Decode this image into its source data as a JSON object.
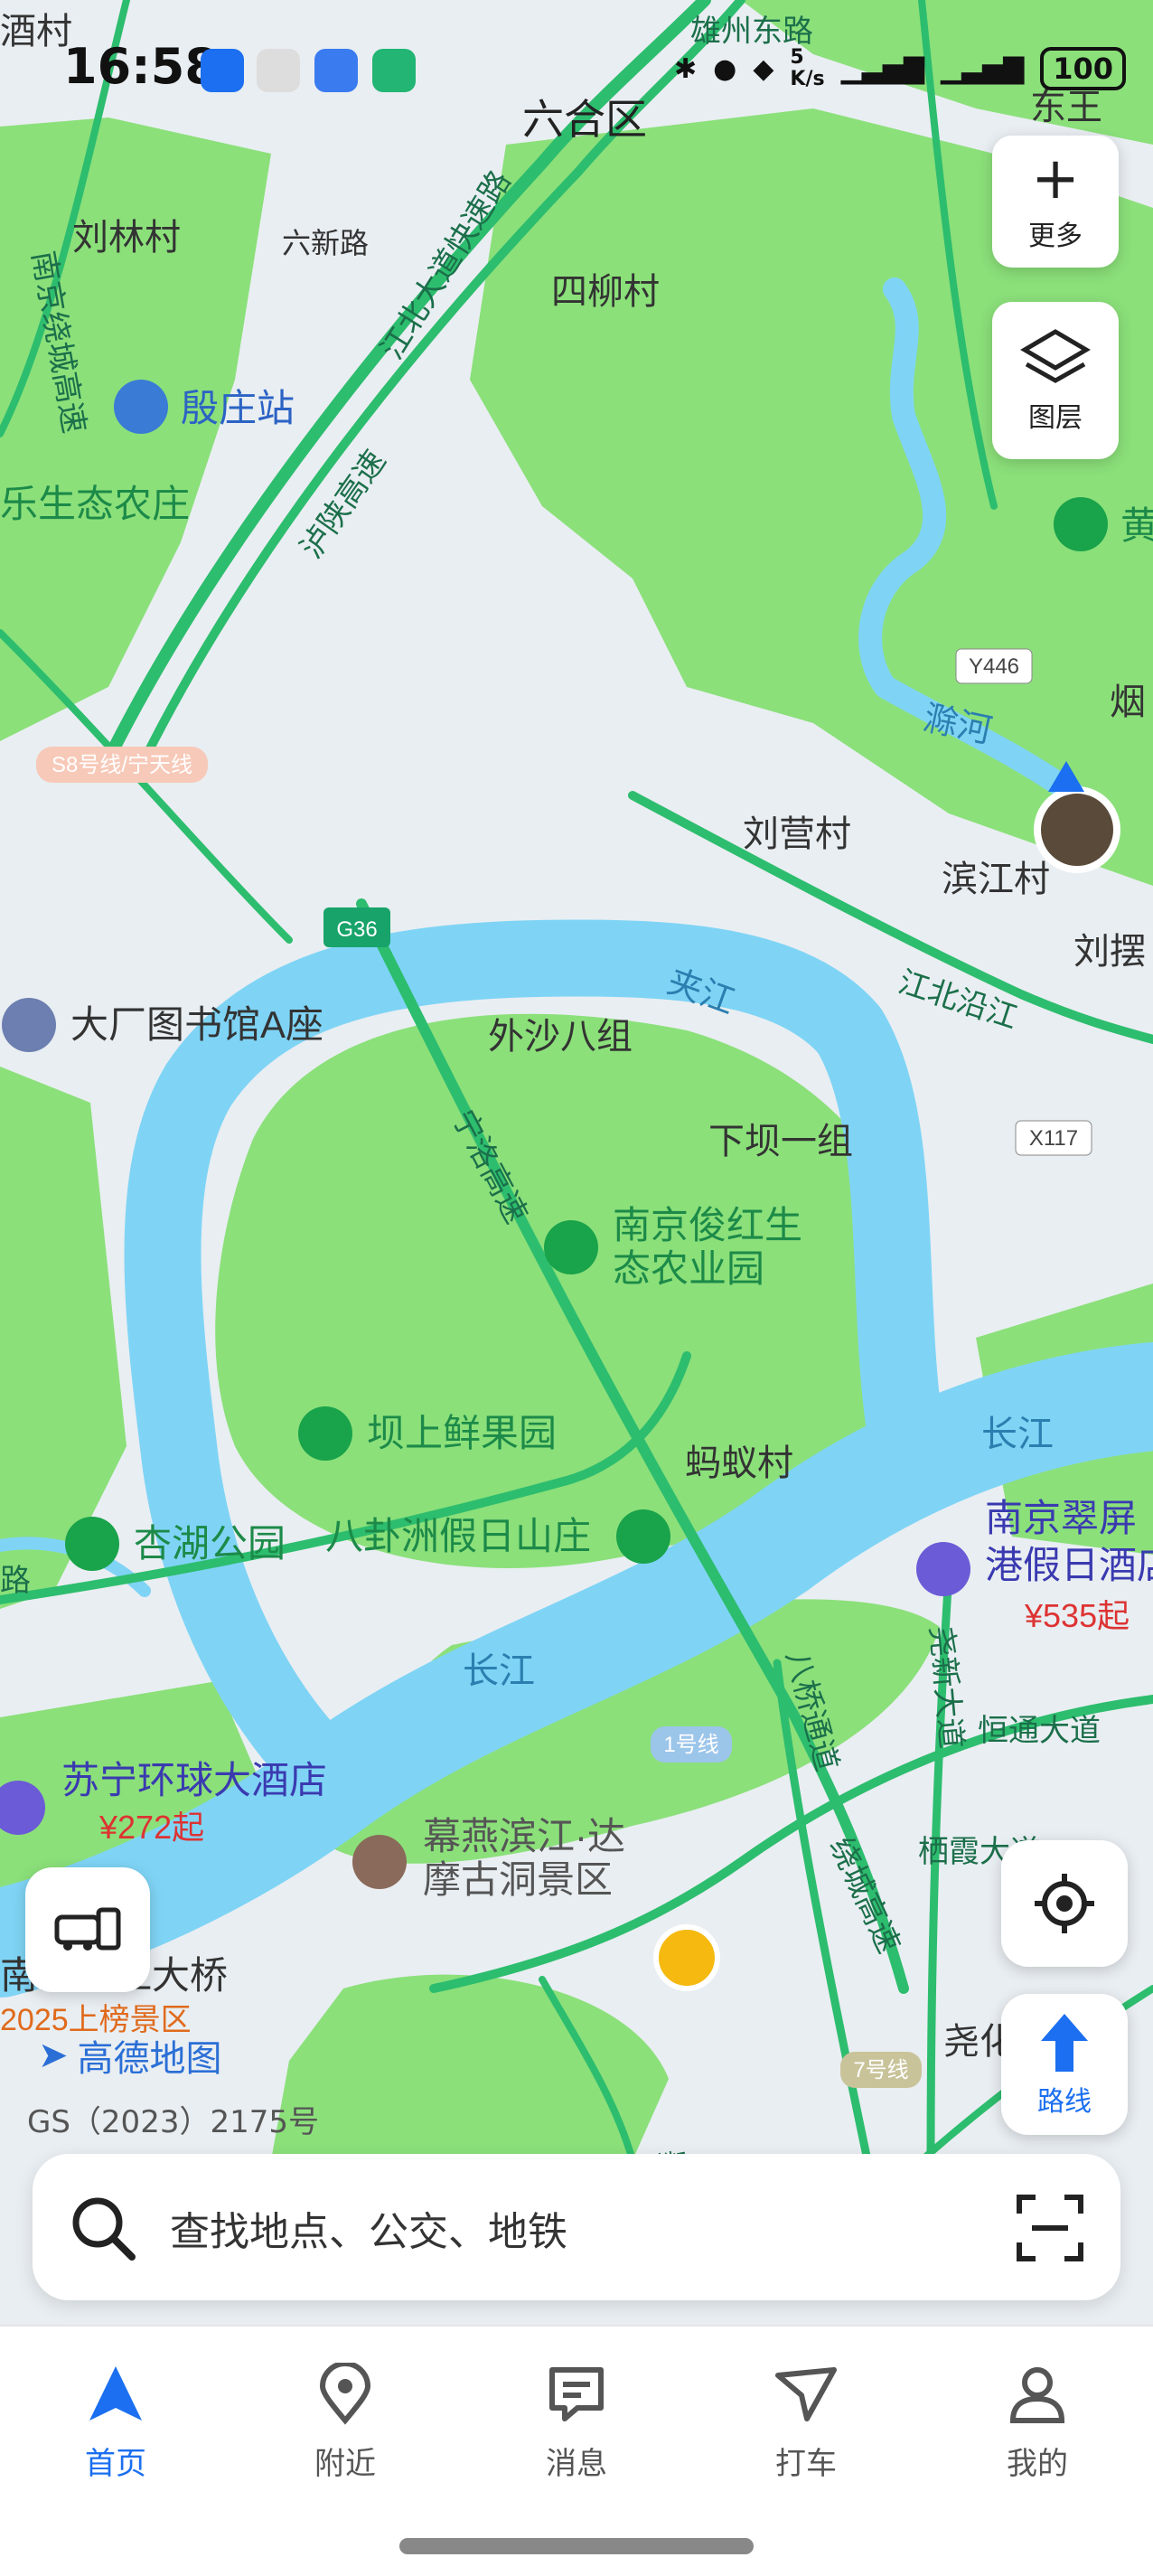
{
  "status_bar": {
    "time": "16:58",
    "net_speed_top": "5",
    "net_speed_bottom": "K/s",
    "battery": "100"
  },
  "map_controls": {
    "more_label": "更多",
    "layers_label": "图层",
    "route_label": "路线"
  },
  "map_labels": {
    "districts": [
      "六合区"
    ],
    "villages": [
      "刘林村",
      "四柳村",
      "刘营村",
      "滨江村",
      "刘摆",
      "外沙八组",
      "下坝一组",
      "蚂蚁村",
      "东王",
      "酒村",
      "烟"
    ],
    "roads": [
      "雄州东路",
      "六新路",
      "江北大道快速路",
      "南京绕城高速",
      "泸陕高速",
      "宁洛高速",
      "江北沿江",
      "恒通大道",
      "尧新大道",
      "栖霞大道",
      "绕城高速",
      "八桥通道",
      "路",
      "墨",
      "尧化"
    ],
    "road_badges": [
      "G36",
      "Y446",
      "X117",
      "S8号线/宁天线",
      "1号线",
      "7号线"
    ],
    "water": [
      "夹江",
      "长江",
      "长江",
      "滁河"
    ],
    "pois": {
      "station": "殷庄站",
      "farm": "乐生态农庄",
      "library": "大厂图书馆A座",
      "farm2_line1": "南京俊红生",
      "farm2_line2": "态农业园",
      "orchard": "坝上鲜果园",
      "park": "杏湖公园",
      "resort": "八卦洲假日山庄",
      "scenic_line1": "幕燕滨江·达",
      "scenic_line2": "摩古洞景区",
      "hotel1_name": "苏宁环球大酒店",
      "hotel1_price": "¥272起",
      "hotel2_line1": "南京翠屏",
      "hotel2_line2": "港假日酒店",
      "hotel2_price": "¥535起",
      "bridge_line1": "南京长江大桥",
      "bridge_line2": "2025上榜景区",
      "yellow_label": "黄"
    }
  },
  "branding": {
    "logo": "高德地图",
    "gs_number": "GS（2023）2175号"
  },
  "search": {
    "placeholder": "查找地点、公交、地铁"
  },
  "bottom_nav": [
    {
      "label": "首页",
      "icon": "navigation-arrow-icon",
      "active": true
    },
    {
      "label": "附近",
      "icon": "location-pin-icon",
      "active": false
    },
    {
      "label": "消息",
      "icon": "message-icon",
      "active": false
    },
    {
      "label": "打车",
      "icon": "taxi-icon",
      "active": false
    },
    {
      "label": "我的",
      "icon": "user-icon",
      "active": false
    }
  ],
  "colors": {
    "water": "#7fd4f5",
    "green": "#8be07a",
    "road_green": "#2dbd6e",
    "primary_blue": "#1b6ff0",
    "land": "#e9eef2"
  }
}
